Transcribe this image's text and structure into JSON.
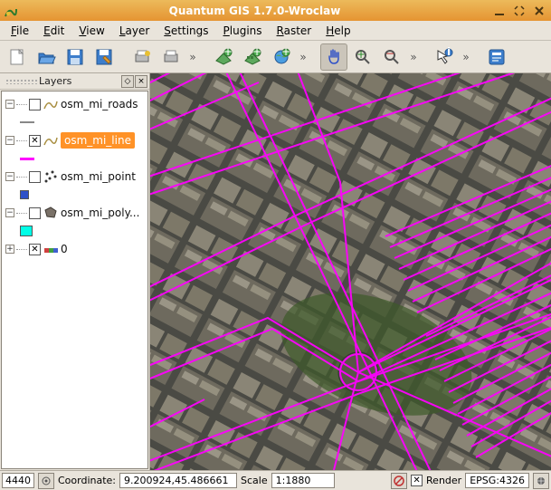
{
  "window": {
    "title": "Quantum GIS 1.7.0-Wroclaw"
  },
  "menu": {
    "file": "File",
    "edit": "Edit",
    "view": "View",
    "layer": "Layer",
    "settings": "Settings",
    "plugins": "Plugins",
    "raster": "Raster",
    "help": "Help"
  },
  "panel": {
    "title": "Layers"
  },
  "layers": [
    {
      "name": "osm_mi_roads",
      "checked": false,
      "swatch": "#ffffff"
    },
    {
      "name": "osm_mi_line",
      "checked": true,
      "selected": true,
      "swatch": "#ff00ff"
    },
    {
      "name": "osm_mi_point",
      "checked": false,
      "swatch": "#2e50c8"
    },
    {
      "name": "osm_mi_poly...",
      "checked": false,
      "swatch": "#00ffe7"
    },
    {
      "name": "0",
      "checked": true,
      "rgb": true
    }
  ],
  "status": {
    "left_num": "4440",
    "coord_label": "Coordinate:",
    "coord_value": "9.200924,45.486661",
    "scale_label": "Scale",
    "scale_value": "1:1880",
    "render_label": "Render",
    "render_checked": true,
    "epsg": "EPSG:4326"
  }
}
